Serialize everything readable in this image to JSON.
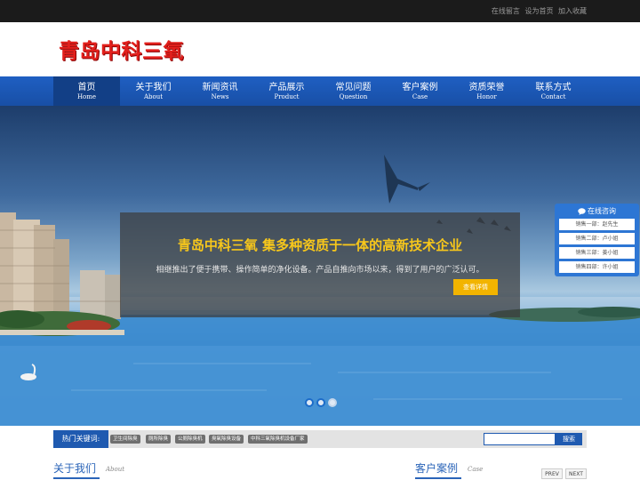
{
  "topbar": {
    "links": [
      "在线留言",
      "设为首页",
      "加入收藏"
    ]
  },
  "header": {
    "logo_text": "青岛中科三氧"
  },
  "nav": {
    "items": [
      {
        "cn": "首页",
        "en": "Home"
      },
      {
        "cn": "关于我们",
        "en": "About"
      },
      {
        "cn": "新闻资讯",
        "en": "News"
      },
      {
        "cn": "产品展示",
        "en": "Product"
      },
      {
        "cn": "常见问题",
        "en": "Question"
      },
      {
        "cn": "客户案例",
        "en": "Case"
      },
      {
        "cn": "资质荣誉",
        "en": "Honor"
      },
      {
        "cn": "联系方式",
        "en": "Contact"
      }
    ],
    "active_index": 0,
    "colors": {
      "bar": "#1f5fc2",
      "active": "#123f86"
    }
  },
  "banner": {
    "title": "青岛中科三氧 集多种资质于一体的高新技术企业",
    "text": "相继推出了便于携带、操作简单的净化设备。产品自推向市场以来，得到了用户的广泛认可。",
    "button_label": "查看详情",
    "title_color": "#f7c71b",
    "slide_count": 3,
    "active_slide": 1
  },
  "chat": {
    "title": "在线咨询",
    "items": [
      "销售一部：赵先生",
      "销售二部：卢小姐",
      "销售三部：姜小姐",
      "销售四部：许小姐"
    ]
  },
  "hot": {
    "label": "热门关键词:",
    "keywords": [
      "卫生间除臭",
      "厕所除臭",
      "公厕除臭机",
      "臭氧除臭设备",
      "中科三氧除臭机设备厂家"
    ],
    "search_placeholder": "",
    "search_button": "搜索"
  },
  "sections": {
    "about": {
      "title": "关于我们",
      "en": "About"
    },
    "case": {
      "title": "客户案例",
      "en": "Case"
    },
    "prev_label": "PREV",
    "next_label": "NEXT"
  }
}
